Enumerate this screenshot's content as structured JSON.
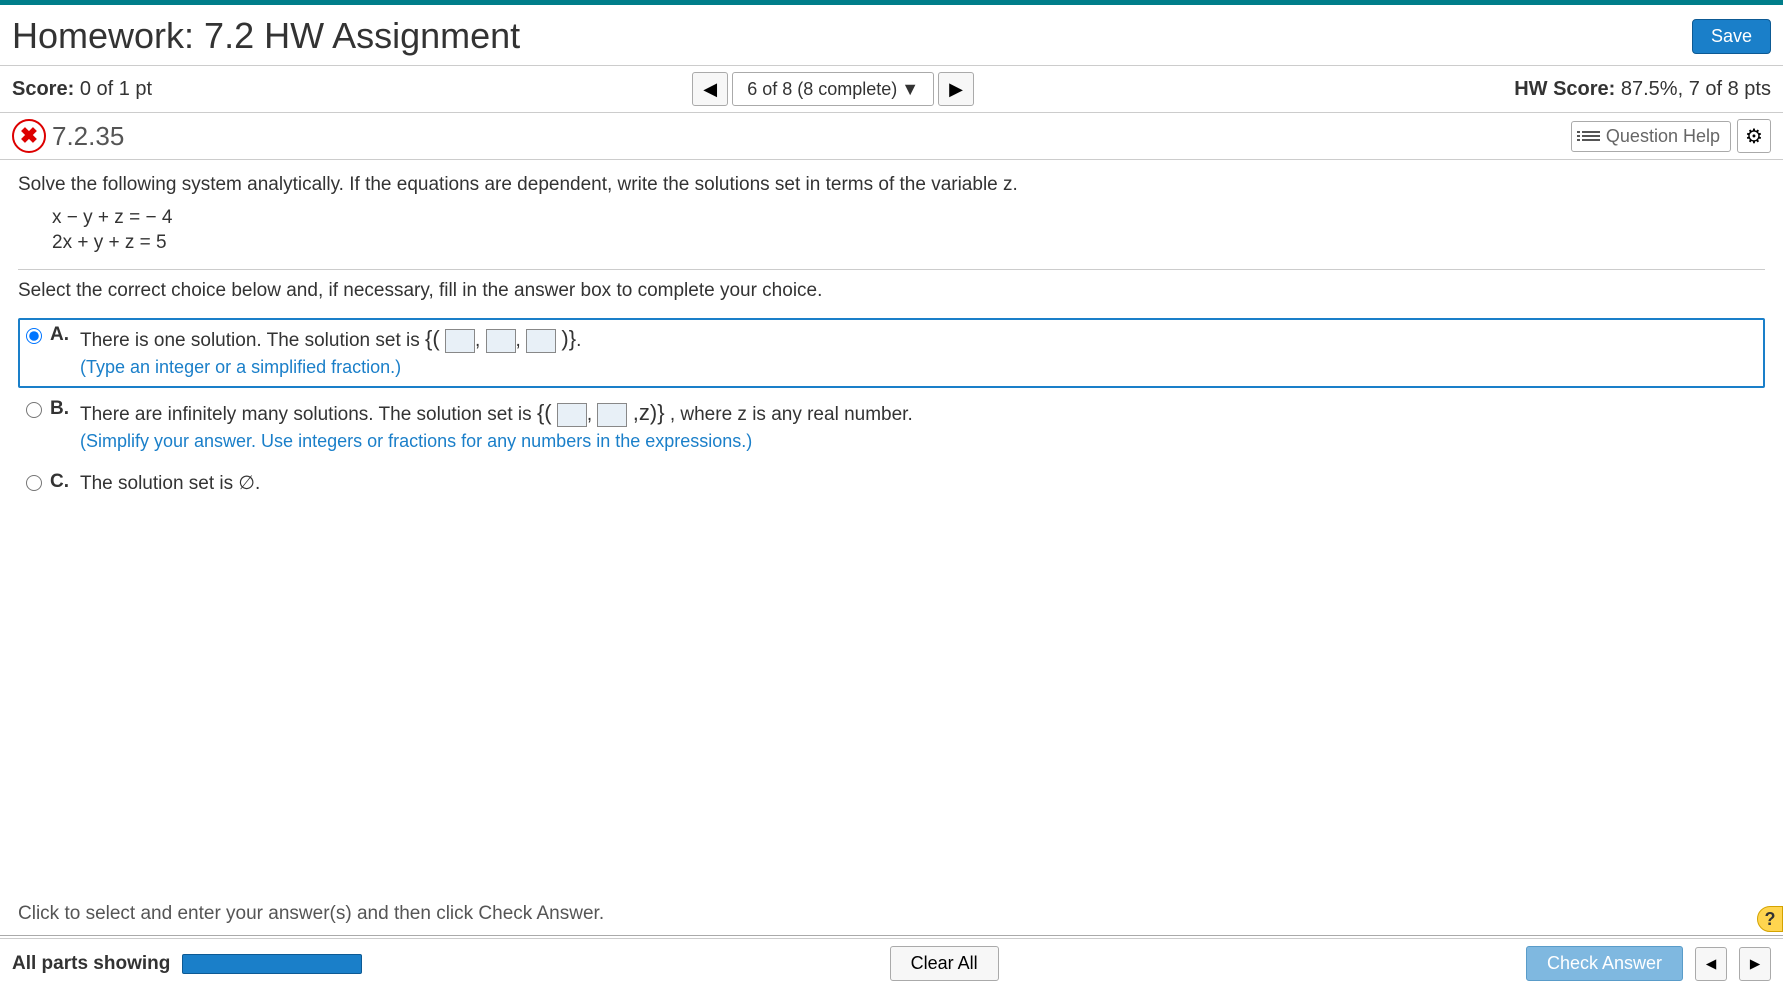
{
  "header": {
    "title": "Homework: 7.2 HW Assignment",
    "save_label": "Save"
  },
  "score_row": {
    "score_prefix": "Score: ",
    "score_value": "0 of 1 pt",
    "nav_text": "6 of 8 (8 complete)",
    "hw_prefix": "HW Score: ",
    "hw_value": "87.5%, 7 of 8 pts"
  },
  "question_row": {
    "status_glyph": "✖",
    "question_number": "7.2.35",
    "help_label": "Question Help"
  },
  "content": {
    "prompt": "Solve the following system analytically. If the equations are dependent, write the solutions set in terms of the variable z.",
    "eq1": "x − y + z =  − 4",
    "eq2": "2x + y + z = 5",
    "instruction": "Select the correct choice below and, if necessary, fill in the answer box to complete your choice."
  },
  "choices": {
    "a": {
      "letter": "A.",
      "text_pre": "There is one solution. The solution set is ",
      "brace_open": "{(",
      "comma": ",",
      "brace_close": ")}",
      "period": ".",
      "hint": "(Type an integer or a simplified fraction.)",
      "selected": true
    },
    "b": {
      "letter": "B.",
      "text_pre": "There are infinitely many solutions. The solution set is ",
      "brace_open": "{(",
      "comma": ",",
      "z_part": ",z)}",
      "text_post": ", where z is any real number.",
      "hint": "(Simplify your answer. Use integers or fractions for any numbers in the expressions.)"
    },
    "c": {
      "letter": "C.",
      "text": "The solution set is ∅."
    }
  },
  "footer": {
    "instruction": "Click to select and enter your answer(s) and then click Check Answer.",
    "parts_label": "All parts showing",
    "clear_label": "Clear All",
    "check_label": "Check Answer",
    "help_glyph": "?"
  }
}
